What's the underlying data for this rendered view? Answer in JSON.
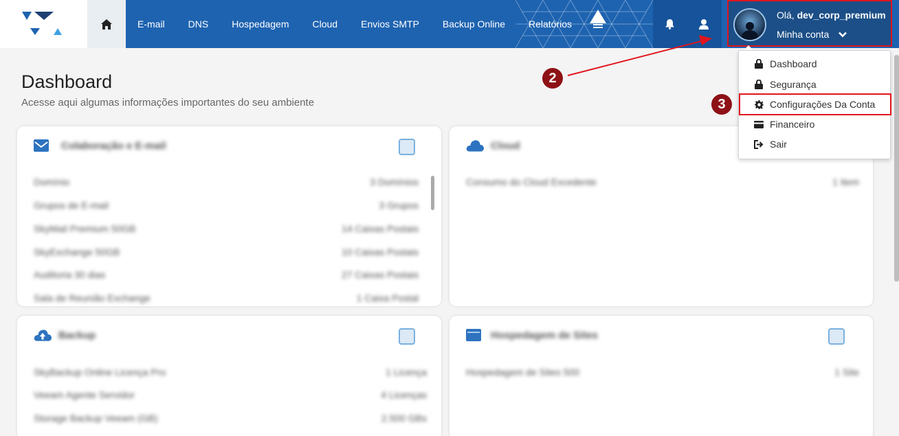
{
  "nav": {
    "home_label": "",
    "items": [
      "E-mail",
      "DNS",
      "Hospedagem",
      "Cloud",
      "Envios SMTP",
      "Backup Online",
      "Relatórios"
    ]
  },
  "account": {
    "greeting": "Olá, ",
    "username": "dev_corp_premium",
    "menu_label": "Minha conta"
  },
  "dropdown": {
    "items": [
      {
        "label": "Dashboard",
        "icon": "lock-icon"
      },
      {
        "label": "Segurança",
        "icon": "lock-icon"
      },
      {
        "label": "Configurações Da Conta",
        "icon": "gear-icon"
      },
      {
        "label": "Financeiro",
        "icon": "credit-card-icon"
      },
      {
        "label": "Sair",
        "icon": "sign-out-icon"
      }
    ]
  },
  "annotations": {
    "step2": "2",
    "step3": "3"
  },
  "page": {
    "title": "Dashboard",
    "subtitle": "Acesse aqui algumas informações importantes do seu ambiente"
  },
  "cards": {
    "email": {
      "title": "Colaboração e E-mail",
      "rows": [
        {
          "label": "Domínio",
          "value": "3 Domínios"
        },
        {
          "label": "Grupos de E-mail",
          "value": "3 Grupos"
        },
        {
          "label": "SkyMail Premium 50GB",
          "value": "14 Caixas Postais"
        },
        {
          "label": "SkyExchange 50GB",
          "value": "10 Caixas Postais"
        },
        {
          "label": "Auditoria 30 dias",
          "value": "27 Caixas Postais"
        },
        {
          "label": "Sala de Reunião Exchange",
          "value": "1 Caixa Postal"
        }
      ]
    },
    "cloud": {
      "title": "Cloud",
      "rows": [
        {
          "label": "Consumo do Cloud Excedente",
          "value": "1 Item"
        }
      ]
    },
    "backup": {
      "title": "Backup",
      "rows": [
        {
          "label": "SkyBackup Online Licença Pro",
          "value": "1 Licença"
        },
        {
          "label": "Veeam Agente Servidor",
          "value": "4 Licenças"
        },
        {
          "label": "Storage Backup Veeam (GB)",
          "value": "2.500 GBs"
        }
      ]
    },
    "hosting": {
      "title": "Hospedagem de Sites",
      "rows": [
        {
          "label": "Hospedagem de Sites 500",
          "value": "1 Site"
        }
      ]
    }
  },
  "colors": {
    "topbar": "#1e63b0",
    "highlight": "#e1141d",
    "badge": "#8e1116"
  }
}
